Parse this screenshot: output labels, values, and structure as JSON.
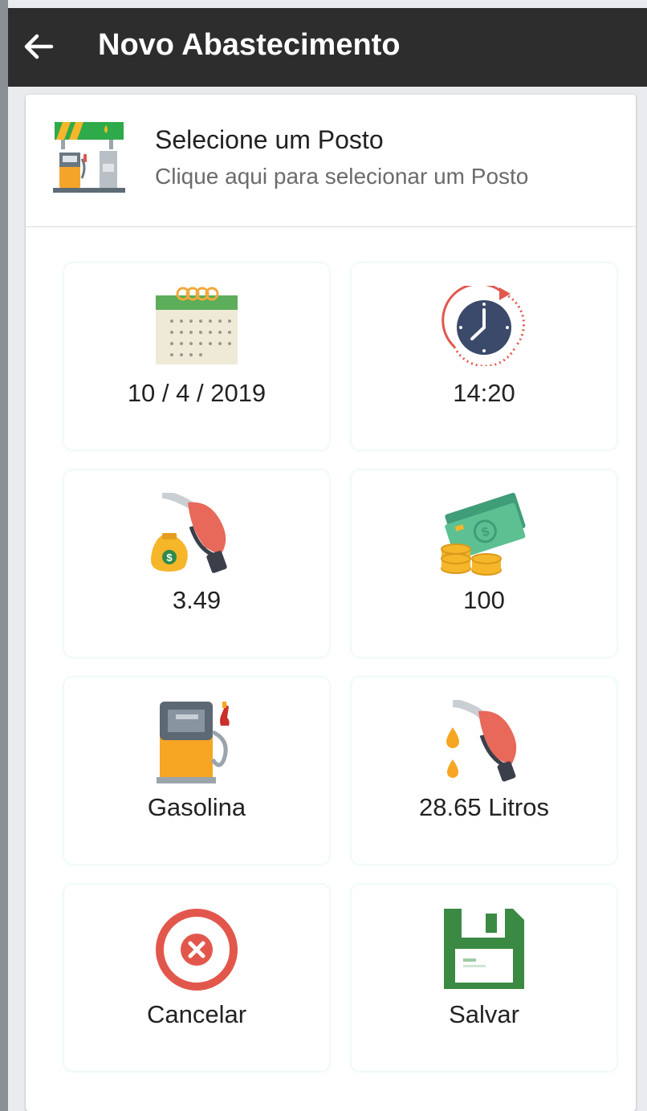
{
  "header": {
    "title": "Novo Abastecimento",
    "back_icon": "arrow-left-icon"
  },
  "station": {
    "title": "Selecione um Posto",
    "subtitle": "Clique aqui para selecionar um Posto",
    "icon": "gas-station-icon"
  },
  "tiles": {
    "date": {
      "label": "10 / 4 / 2019",
      "icon": "calendar-icon"
    },
    "time": {
      "label": "14:20",
      "icon": "clock-icon"
    },
    "price": {
      "label": "3.49",
      "icon": "fuel-price-icon"
    },
    "amount": {
      "label": "100",
      "icon": "money-icon"
    },
    "fuel": {
      "label": "Gasolina",
      "icon": "fuel-pump-icon"
    },
    "liters": {
      "label": "28.65 Litros",
      "icon": "fuel-nozzle-drops-icon"
    },
    "cancel": {
      "label": "Cancelar",
      "icon": "cancel-icon"
    },
    "save": {
      "label": "Salvar",
      "icon": "save-icon"
    }
  },
  "colors": {
    "toolbar": "#2d2d2d",
    "cancel_red": "#e2574c",
    "save_green": "#3a8a44",
    "clock_blue": "#3b4a6b",
    "money_green": "#4fb08c",
    "fuel_orange": "#f6a623"
  }
}
